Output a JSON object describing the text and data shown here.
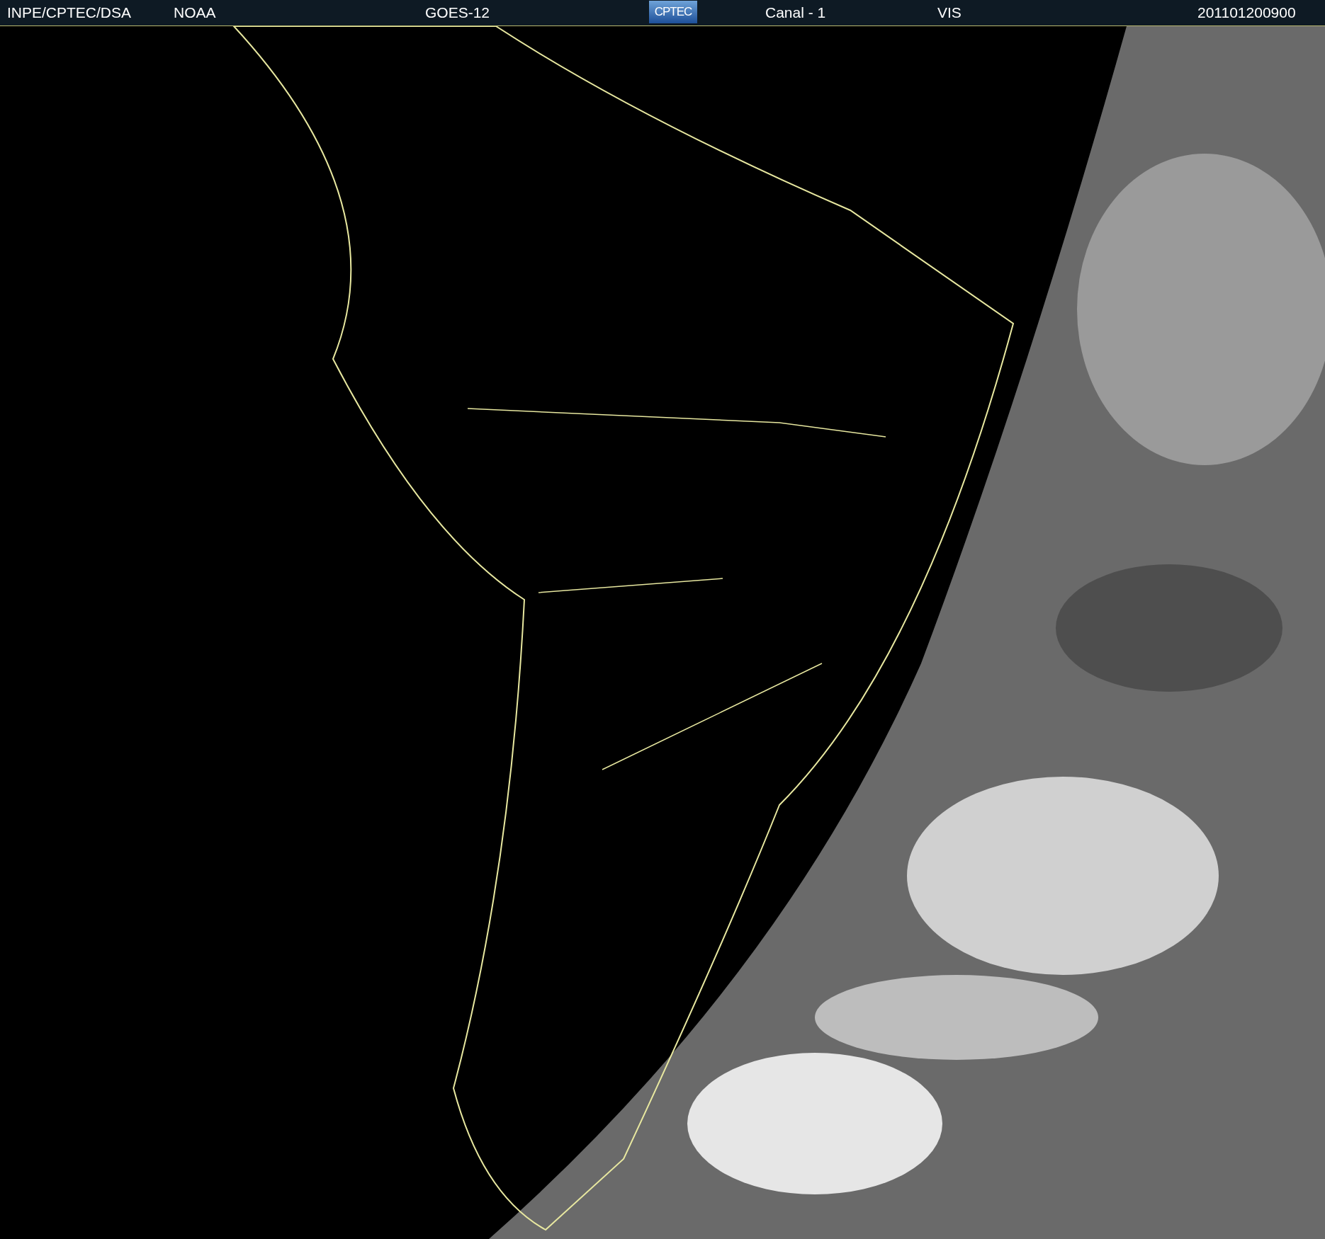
{
  "header": {
    "source": "INPE/CPTEC/DSA",
    "agency": "NOAA",
    "satellite": "GOES-12",
    "logo": "CPTEC",
    "channel": "Canal - 1",
    "band": "VIS",
    "timestamp": "201101200900"
  }
}
